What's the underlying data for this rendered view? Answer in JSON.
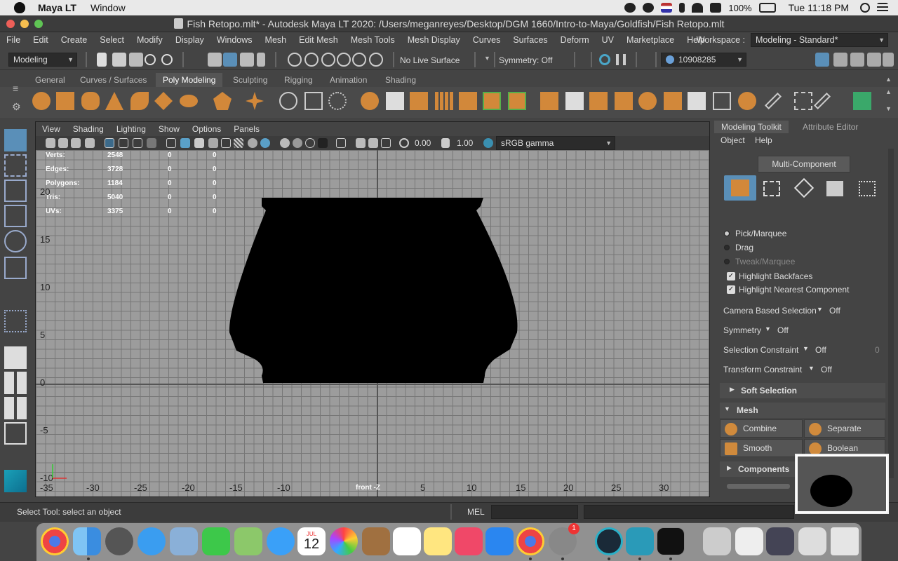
{
  "menubar": {
    "app": "Maya LT",
    "items": [
      "Window"
    ],
    "battery": "100%",
    "clock": "Tue 11:18 PM"
  },
  "window": {
    "title": "Fish Retopo.mlt* - Autodesk Maya LT 2020: /Users/meganreyes/Desktop/DGM 1660/Intro-to-Maya/Goldfish/Fish Retopo.mlt"
  },
  "mainmenu": {
    "items": [
      "File",
      "Edit",
      "Create",
      "Select",
      "Modify",
      "Display",
      "Windows",
      "Mesh",
      "Edit Mesh",
      "Mesh Tools",
      "Mesh Display",
      "Curves",
      "Surfaces",
      "Deform",
      "UV",
      "Marketplace",
      "Help"
    ],
    "workspace_label": "Workspace :",
    "workspace_value": "Modeling - Standard*"
  },
  "statusline": {
    "mode": "Modeling",
    "live_surface": "No Live Surface",
    "symmetry": "Symmetry: Off",
    "user_id": "10908285"
  },
  "shelf": {
    "tabs": [
      "General",
      "Curves / Surfaces",
      "Poly Modeling",
      "Sculpting",
      "Rigging",
      "Animation",
      "Shading"
    ],
    "active": "Poly Modeling"
  },
  "viewport": {
    "menu": [
      "View",
      "Shading",
      "Lighting",
      "Show",
      "Options",
      "Panels"
    ],
    "exposure": "0.00",
    "gamma": "1.00",
    "colorspace": "sRGB gamma",
    "camera_label": "front -Z",
    "hud": [
      {
        "label": "Verts:",
        "v1": "2548",
        "v2": "0",
        "v3": "0"
      },
      {
        "label": "Edges:",
        "v1": "3728",
        "v2": "0",
        "v3": "0"
      },
      {
        "label": "Polygons:",
        "v1": "1184",
        "v2": "0",
        "v3": "0"
      },
      {
        "label": "Tris:",
        "v1": "5040",
        "v2": "0",
        "v3": "0"
      },
      {
        "label": "UVs:",
        "v1": "3375",
        "v2": "0",
        "v3": "0"
      }
    ],
    "y_ticks": [
      "20",
      "15",
      "10",
      "5",
      "0",
      "-5",
      "-10"
    ],
    "x_ticks": [
      "-35",
      "-30",
      "-25",
      "-20",
      "-15",
      "-10",
      "5",
      "10",
      "15",
      "20",
      "25",
      "30"
    ]
  },
  "toolkit": {
    "tabs": [
      "Modeling Toolkit",
      "Attribute Editor"
    ],
    "menu": [
      "Object",
      "Help"
    ],
    "multi_component": "Multi-Component",
    "pick_modes": [
      "Pick/Marquee",
      "Drag",
      "Tweak/Marquee"
    ],
    "highlight_backfaces": "Highlight Backfaces",
    "highlight_nearest": "Highlight Nearest Component",
    "camera_based": {
      "label": "Camera Based Selection",
      "value": "Off"
    },
    "symmetry": {
      "label": "Symmetry",
      "value": "Off"
    },
    "selection_constraint": {
      "label": "Selection Constraint",
      "value": "Off",
      "extra": "0"
    },
    "transform_constraint": {
      "label": "Transform Constraint",
      "value": "Off"
    },
    "soft_selection": "Soft Selection",
    "mesh_section": "Mesh",
    "mesh_buttons": [
      "Combine",
      "Separate",
      "Smooth",
      "Boolean"
    ],
    "components": "Components"
  },
  "helpline": {
    "text": "Select Tool: select an object",
    "cmd_label": "MEL"
  },
  "dock": {
    "calendar_month": "JUL",
    "calendar_day": "12",
    "badge": "1"
  }
}
